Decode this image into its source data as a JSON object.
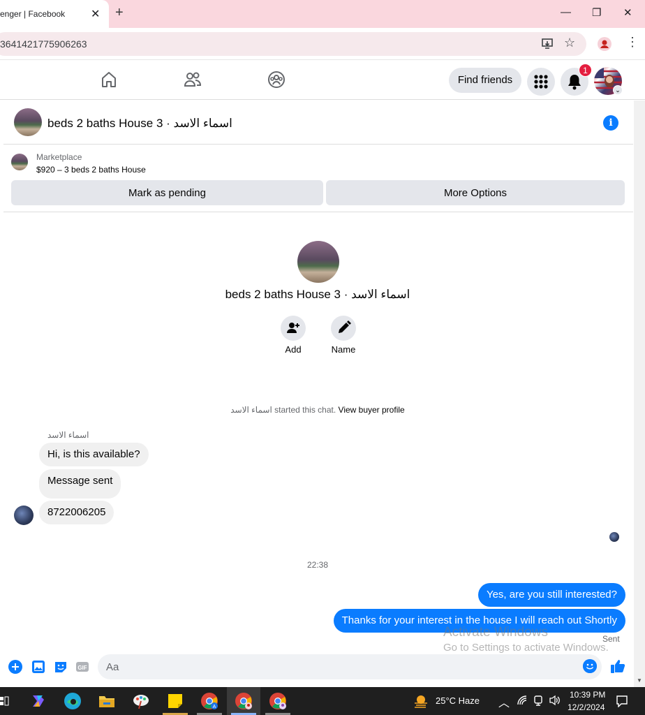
{
  "browser": {
    "tab_title": "enger | Facebook",
    "url": "3641421775906263"
  },
  "nav": {
    "find_friends": "Find friends",
    "notification_count": "1"
  },
  "chat": {
    "title": "beds 2 baths House 3 · اسماء الاسد",
    "marketplace_label": "Marketplace",
    "listing": "$920 – 3 beds 2 baths House",
    "mark_pending": "Mark as pending",
    "more_options": "More Options",
    "center_name": "beds 2 baths House 3 · اسماء الاسد",
    "add_label": "Add",
    "name_label": "Name",
    "system_prefix": "اسماء الاسد started this chat.",
    "system_link": "View buyer profile",
    "sender_name": "اسماء الاسد",
    "messages_in": [
      "Hi, is this available?",
      "Message sent",
      "8722006205"
    ],
    "timestamp": "22:38",
    "messages_out": [
      "Yes, are you still interested?",
      "Thanks for your interest in the house I will reach out Shortly"
    ],
    "sent_status": "Sent",
    "input_placeholder": "Aa"
  },
  "watermark": {
    "line1": "Activate Windows",
    "line2": "Go to Settings to activate Windows."
  },
  "taskbar": {
    "weather": "25°C  Haze",
    "time": "10:39 PM",
    "date": "12/2/2024"
  },
  "colors": {
    "accent": "#0a7cff",
    "tab_strip": "#fad7de",
    "badge": "#e41e3f"
  }
}
